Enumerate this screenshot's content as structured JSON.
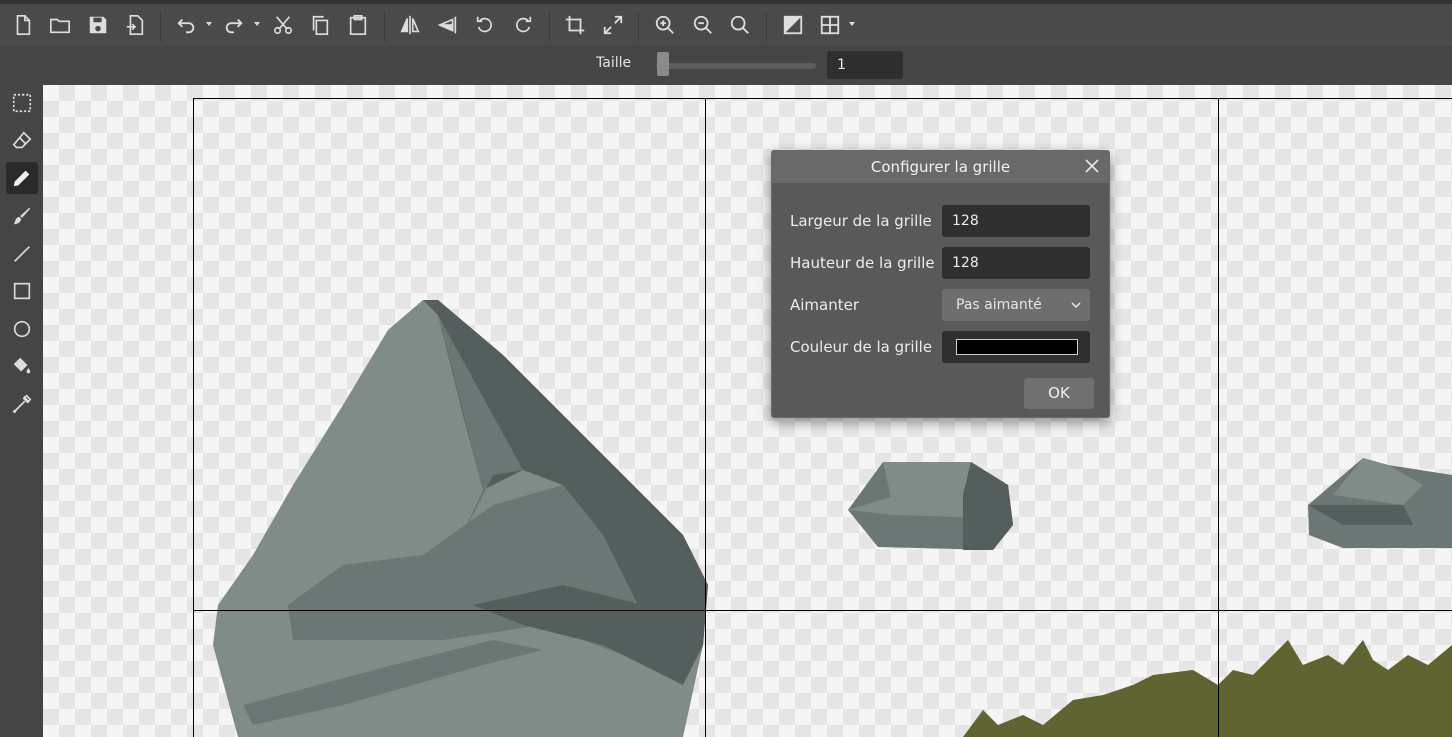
{
  "toolbar": {
    "icons": [
      "new-file-icon",
      "open-folder-icon",
      "save-icon",
      "export-icon",
      "undo-icon",
      "redo-icon",
      "cut-icon",
      "copy-icon",
      "paste-icon",
      "flip-horizontal-icon",
      "flip-vertical-icon",
      "rotate-left-icon",
      "rotate-right-icon",
      "crop-icon",
      "resize-icon",
      "zoom-in-icon",
      "zoom-out-icon",
      "zoom-reset-icon",
      "color-swap-icon",
      "grid-icon"
    ]
  },
  "options": {
    "size_label": "Taille",
    "size_value": "1",
    "size_slider_fraction": 0.02
  },
  "tools": [
    "select-icon",
    "eraser-icon",
    "pencil-icon",
    "brush-icon",
    "line-icon",
    "rectangle-icon",
    "circle-icon",
    "fill-bucket-icon",
    "eyedropper-icon"
  ],
  "active_tool": "pencil-icon",
  "dialog": {
    "title": "Configurer la grille",
    "width_label": "Largeur de la grille",
    "width_value": "128",
    "height_label": "Hauteur de la grille",
    "height_value": "128",
    "snap_label": "Aimanter",
    "snap_value": "Pas aimanté",
    "color_label": "Couleur de la grille",
    "color_value": "#000000",
    "ok_label": "OK"
  },
  "colors": {
    "rock_light": "#7f8c88",
    "rock_mid": "#6b7774",
    "rock_dark": "#545e5c",
    "grass": "#5f6430"
  }
}
